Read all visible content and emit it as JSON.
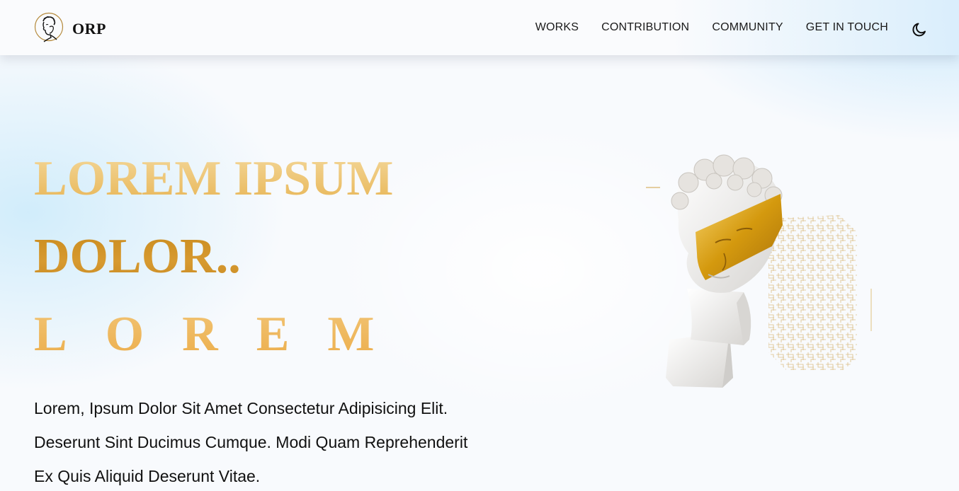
{
  "brand": {
    "name": "ORP",
    "logo_icon": "classical-head-medallion"
  },
  "nav": {
    "items": [
      {
        "label": "WORKS"
      },
      {
        "label": "CONTRIBUTION"
      },
      {
        "label": "COMMUNITY"
      },
      {
        "label": "GET IN TOUCH"
      }
    ],
    "theme_toggle_icon": "moon-icon"
  },
  "hero": {
    "line1": "LOREM IPSUM",
    "line2": "DOLOR..",
    "line3": "LOREM",
    "description": "Lorem, Ipsum Dolor Sit Amet Consectetur Adipisicing Elit. Deserunt Sint Ducimus Cumque. Modi Quam Reprehenderit Ex Quis Aliquid Deserunt Vitae.",
    "image_icon": "gold-masked-statue-bust"
  },
  "colors": {
    "gold_light": "#edc46c",
    "gold_dark": "#c88a22",
    "gold_bright": "#f0b85c",
    "background": "#f8fafd",
    "text": "#111111"
  }
}
